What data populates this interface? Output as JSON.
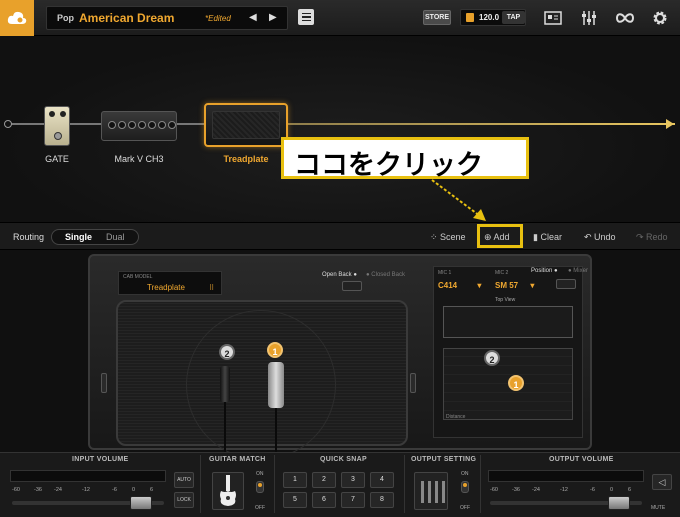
{
  "topbar": {
    "preset_category": "Pop",
    "preset_name": "American Dream",
    "preset_status": "*Edited",
    "prev_arrow": "◀",
    "next_arrow": "▶",
    "store_label": "STORE",
    "tempo": "120.0",
    "tap_label": "TAP"
  },
  "chain": {
    "blocks": [
      {
        "label": "GATE"
      },
      {
        "label": "Mark V CH3"
      },
      {
        "label": "Treadplate"
      }
    ]
  },
  "callout": {
    "text": "ココをクリック"
  },
  "routing": {
    "label": "Routing",
    "single": "Single",
    "dual": "Dual",
    "scene": "Scene",
    "add": "Add",
    "clear": "Clear",
    "undo": "Undo",
    "redo": "Redo"
  },
  "cab": {
    "model_caption": "CAB MODEL",
    "model_name": "Treadplate",
    "open_back": "Open Back ●",
    "closed_back": "● Closed Back",
    "mic1_label": "MIC 1",
    "mic1_value": "C414",
    "mic2_label": "MIC 2",
    "mic2_value": "SM 57",
    "position_label": "Position ●",
    "mixer_label": "● Mixer",
    "top_view_label": "Top View",
    "distance_label": "Distance",
    "badge_1": "1",
    "badge_2": "2"
  },
  "bottom": {
    "input_volume": "INPUT VOLUME",
    "guitar_match": "GUITAR MATCH",
    "quick_snap": "QUICK SNAP",
    "output_setting": "OUTPUT SETTING",
    "output_volume": "OUTPUT VOLUME",
    "auto": "AUTO",
    "lock": "LOCK",
    "on": "ON",
    "off": "OFF",
    "mute": "MUTE",
    "scale": [
      "-60",
      "-36",
      "-24",
      "-12",
      "-6",
      "0",
      "6"
    ],
    "snaps": [
      "1",
      "2",
      "3",
      "4",
      "5",
      "6",
      "7",
      "8"
    ]
  },
  "colors": {
    "accent": "#e8a12b",
    "highlight": "#e8c010"
  }
}
